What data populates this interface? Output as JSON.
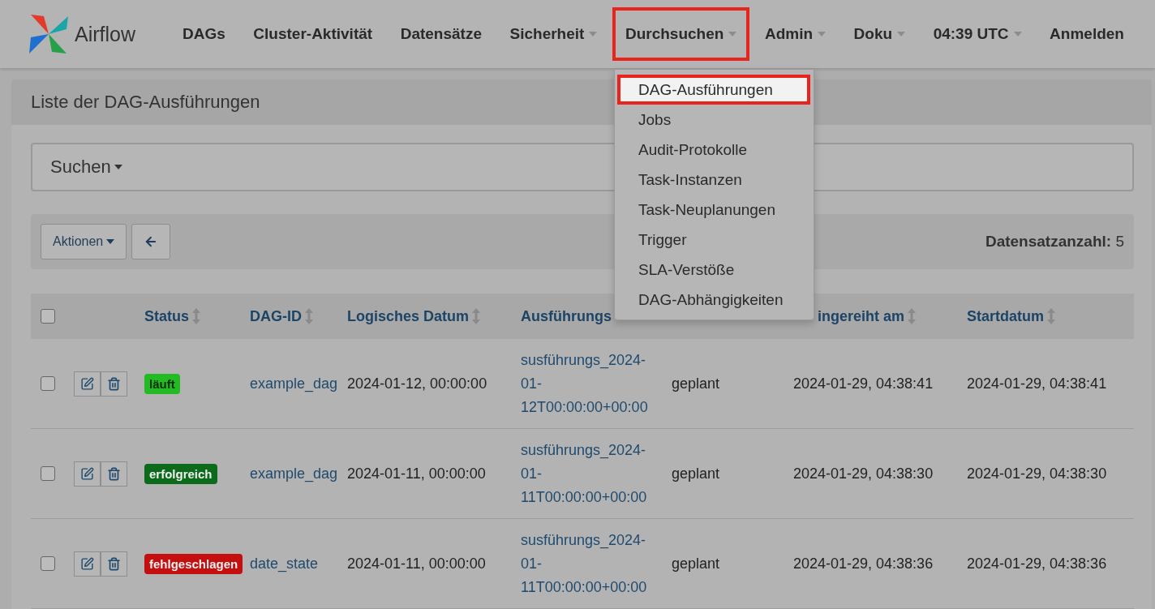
{
  "brand": {
    "name": "Airflow"
  },
  "nav": [
    {
      "label": "DAGs",
      "dropdown": false,
      "highlighted": false
    },
    {
      "label": "Cluster-Aktivität",
      "dropdown": false,
      "highlighted": false
    },
    {
      "label": "Datensätze",
      "dropdown": false,
      "highlighted": false
    },
    {
      "label": "Sicherheit",
      "dropdown": true,
      "highlighted": false
    },
    {
      "label": "Durchsuchen",
      "dropdown": true,
      "highlighted": true
    },
    {
      "label": "Admin",
      "dropdown": true,
      "highlighted": false
    },
    {
      "label": "Doku",
      "dropdown": true,
      "highlighted": false
    },
    {
      "label": "04:39 UTC",
      "dropdown": true,
      "highlighted": false
    },
    {
      "label": "Anmelden",
      "dropdown": false,
      "highlighted": false
    }
  ],
  "menu": [
    {
      "label": "DAG-Ausführungen",
      "highlighted": true
    },
    {
      "label": "Jobs",
      "highlighted": false
    },
    {
      "label": "Audit-Protokolle",
      "highlighted": false
    },
    {
      "label": "Task-Instanzen",
      "highlighted": false
    },
    {
      "label": "Task-Neuplanungen",
      "highlighted": false
    },
    {
      "label": "Trigger",
      "highlighted": false
    },
    {
      "label": "SLA-Verstöße",
      "highlighted": false
    },
    {
      "label": "DAG-Abhängigkeiten",
      "highlighted": false
    }
  ],
  "panel": {
    "title": "Liste der DAG-Ausführungen"
  },
  "search": {
    "label": "Suchen"
  },
  "toolbar": {
    "actions": "Aktionen",
    "record_label": "Datensatzanzahl:",
    "record_count": "5"
  },
  "table": {
    "columns": [
      {
        "kind": "checkbox",
        "checked": false
      },
      {
        "kind": "blank"
      },
      {
        "kind": "label",
        "label": "Status",
        "sortable": true
      },
      {
        "kind": "label",
        "label": "DAG-ID",
        "sortable": true
      },
      {
        "kind": "label",
        "label": "Logisches Datum",
        "sortable": true
      },
      {
        "kind": "label",
        "label": "Ausführungs"
      },
      {
        "kind": "blank"
      },
      {
        "kind": "label",
        "label": "ingereiht am",
        "sortable": true
      },
      {
        "kind": "label",
        "label": "Startdatum",
        "sortable": true
      }
    ],
    "rows": [
      {
        "checked": false,
        "status": "läuft",
        "color": "#22bb22",
        "dag_id": "example_dag",
        "logical_date": "2024-01-12, 00:00:00",
        "run_id": "susführungs_2024-01-12T00:00:00+00:00",
        "run_type": "geplant",
        "queued": "2024-01-29, 04:38:41",
        "start": "2024-01-29, 04:38:41"
      },
      {
        "checked": false,
        "status": "erfolgreich",
        "color": "#0b6b1a",
        "dag_id": "example_dag",
        "logical_date": "2024-01-11, 00:00:00",
        "run_id": "susführungs_2024-01-11T00:00:00+00:00",
        "run_type": "geplant",
        "queued": "2024-01-29, 04:38:30",
        "start": "2024-01-29, 04:38:30"
      },
      {
        "checked": false,
        "status": "fehlgeschlagen",
        "color": "#c50f0f",
        "dag_id": "date_state",
        "logical_date": "2024-01-11, 00:00:00",
        "run_id": "susführungs_2024-01-11T00:00:00+00:00",
        "run_type": "geplant",
        "queued": "2024-01-29, 04:38:36",
        "start": "2024-01-29, 04:38:36"
      }
    ]
  }
}
